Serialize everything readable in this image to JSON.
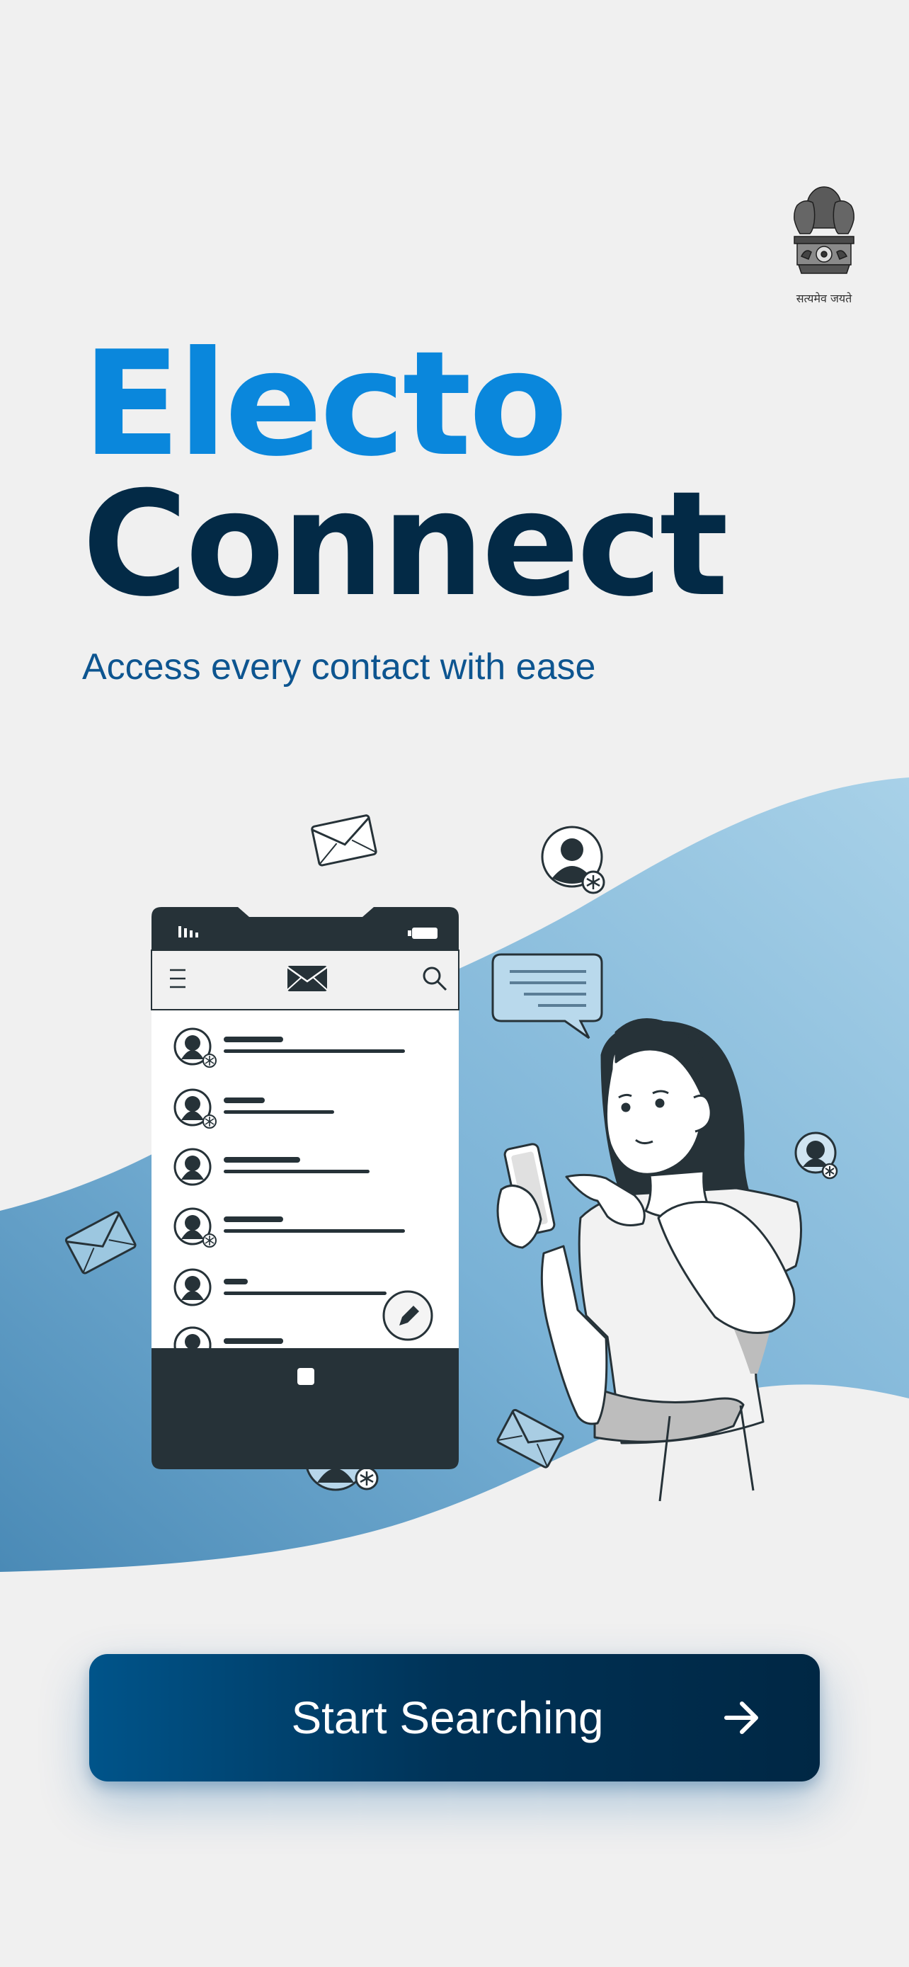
{
  "app": {
    "title_line_1": "Electo",
    "title_line_2": "Connect",
    "tagline": "Access every contact with ease"
  },
  "emblem": {
    "icon": "national-emblem-icon",
    "motto": "सत्यमेव जयते"
  },
  "cta": {
    "label": "Start Searching",
    "icon": "arrow-right-icon"
  },
  "colors": {
    "background": "#f0f0f0",
    "title_blue": "#0a87dc",
    "title_navy": "#032a46",
    "tagline": "#0d5590",
    "button_start": "#00548a",
    "button_end": "#002744",
    "wave_light": "#a2cde6",
    "wave_dark": "#4a8db8",
    "illustration_ink": "#263238"
  }
}
